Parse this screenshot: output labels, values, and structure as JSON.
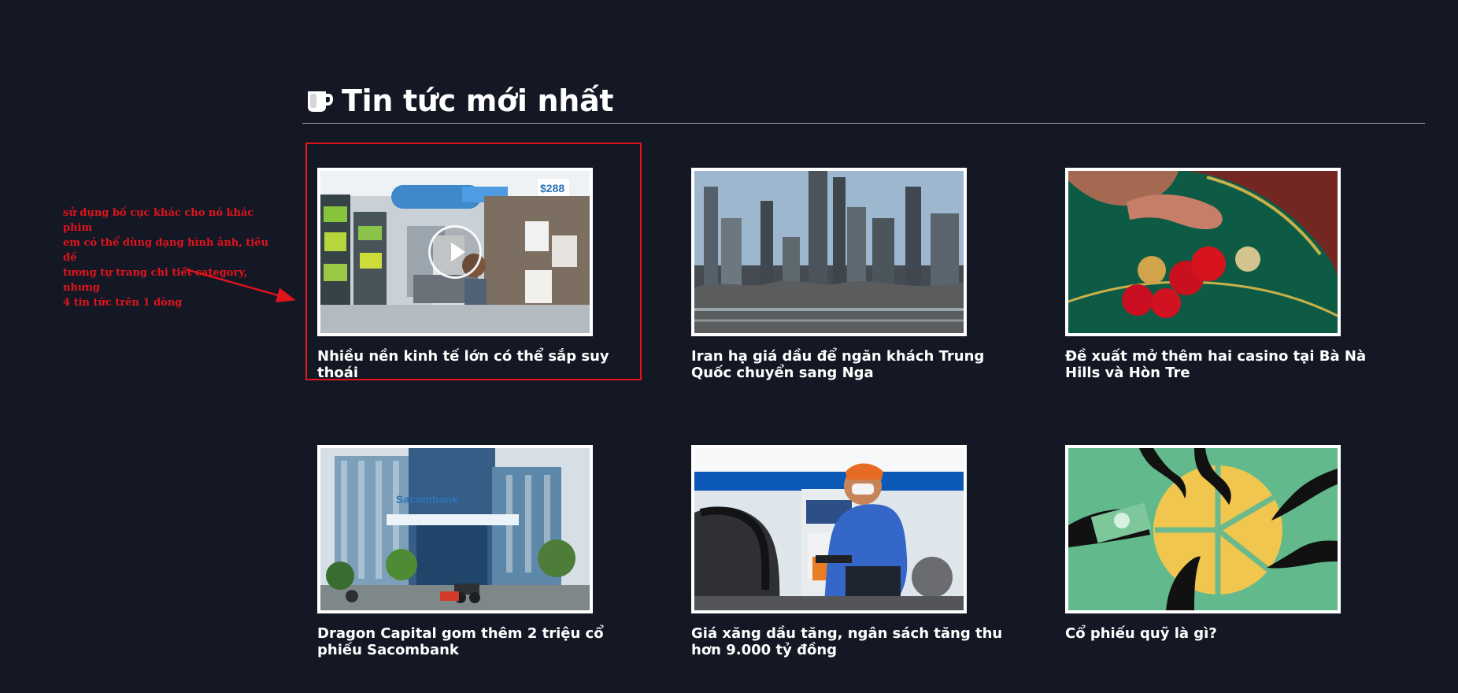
{
  "annotation": {
    "text": "sử dụng bố cục khác cho nó khác phim\nem có thể dùng dạng hình ảnh, tiêu đề\ntương tự trang chi tiết category, nhưng\n4 tin tức trên 1 dòng",
    "color": "#e0141c"
  },
  "section": {
    "title": "Tin tức mới nhất",
    "icon": "coffee-mug-icon"
  },
  "articles": [
    {
      "title": "Nhiều nền kinh tế lớn có thể sắp suy thoái",
      "image": "store-shopping-scene",
      "has_video": true,
      "highlighted": true,
      "image_text": "$288"
    },
    {
      "title": "Iran hạ giá dầu để ngăn khách Trung Quốc chuyển sang Nga",
      "image": "oil-refinery-scene",
      "has_video": false,
      "highlighted": false
    },
    {
      "title": "Đề xuất mở thêm hai casino tại Bà Nà Hills và Hòn Tre",
      "image": "casino-chips-scene",
      "has_video": false,
      "highlighted": false
    },
    {
      "title": "Dragon Capital gom thêm 2 triệu cổ phiếu Sacombank",
      "image": "sacombank-building-scene",
      "has_video": false,
      "highlighted": false,
      "image_text": "Sacombank"
    },
    {
      "title": "Giá xăng dầu tăng, ngân sách tăng thu hơn 9.000 tỷ đồng",
      "image": "fuel-station-scene",
      "has_video": false,
      "highlighted": false
    },
    {
      "title": "Cổ phiếu quỹ là gì?",
      "image": "hands-pie-chart-scene",
      "has_video": false,
      "highlighted": false
    }
  ],
  "colors": {
    "background": "#141824",
    "text": "#ffffff",
    "accent_red": "#e0141c",
    "divider": "#9aa0ac"
  }
}
